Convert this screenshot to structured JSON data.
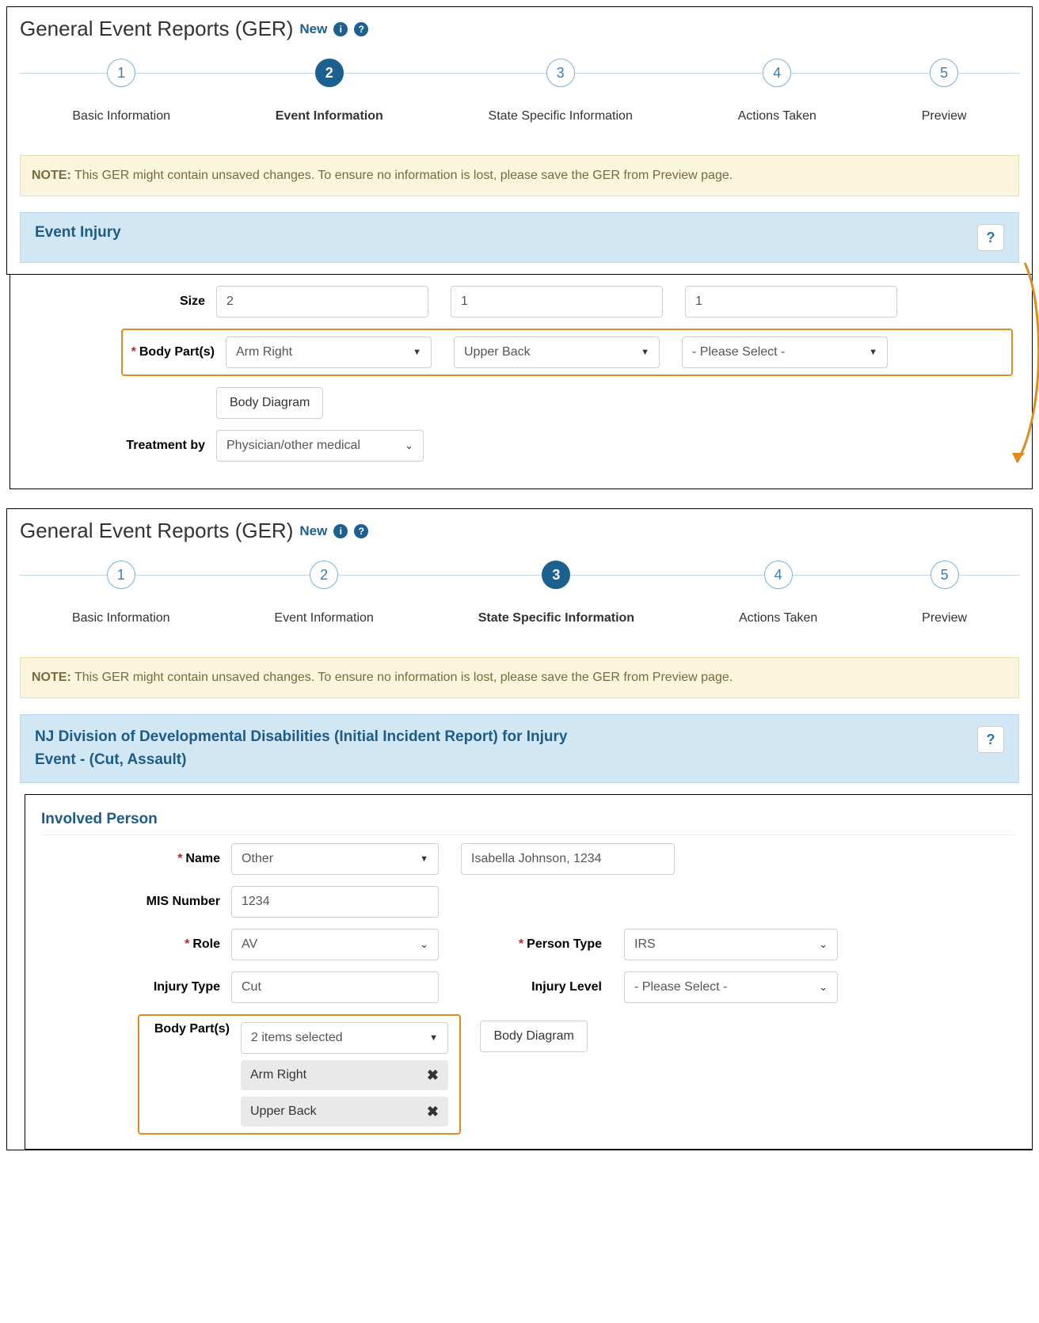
{
  "title": "General Event Reports (GER)",
  "new_label": "New",
  "stepper": {
    "steps": [
      {
        "num": "1",
        "label": "Basic Information"
      },
      {
        "num": "2",
        "label": "Event Information"
      },
      {
        "num": "3",
        "label": "State Specific Information"
      },
      {
        "num": "4",
        "label": "Actions Taken"
      },
      {
        "num": "5",
        "label": "Preview"
      }
    ]
  },
  "note": {
    "prefix": "NOTE:",
    "text": " This GER might contain unsaved changes. To ensure no information is lost, please save the GER from Preview page."
  },
  "panel1": {
    "section_title": "Event Injury",
    "help": "?",
    "size_label": "Size",
    "size_values": [
      "2",
      "1",
      "1"
    ],
    "body_parts_label": "Body Part(s)",
    "body_parts": [
      "Arm Right",
      "Upper Back",
      "- Please Select -"
    ],
    "body_diagram_label": "Body Diagram",
    "treatment_label": "Treatment by",
    "treatment_value": "Physician/other medical"
  },
  "panel2": {
    "section_title": "NJ Division of Developmental Disabilities (Initial Incident Report) for Injury Event - (Cut, Assault)",
    "involved_title": "Involved Person",
    "help": "?",
    "name_label": "Name",
    "name_select": "Other",
    "name_text": "Isabella Johnson, 1234",
    "mis_label": "MIS Number",
    "mis_value": "1234",
    "role_label": "Role",
    "role_value": "AV",
    "person_type_label": "Person Type",
    "person_type_value": "IRS",
    "injury_type_label": "Injury Type",
    "injury_type_value": "Cut",
    "injury_level_label": "Injury Level",
    "injury_level_value": "- Please Select -",
    "body_parts2_label": "Body Part(s)",
    "body_parts2_count": "2 items selected",
    "body_parts2_chips": [
      "Arm Right",
      "Upper Back"
    ],
    "body_diagram2_label": "Body Diagram"
  }
}
